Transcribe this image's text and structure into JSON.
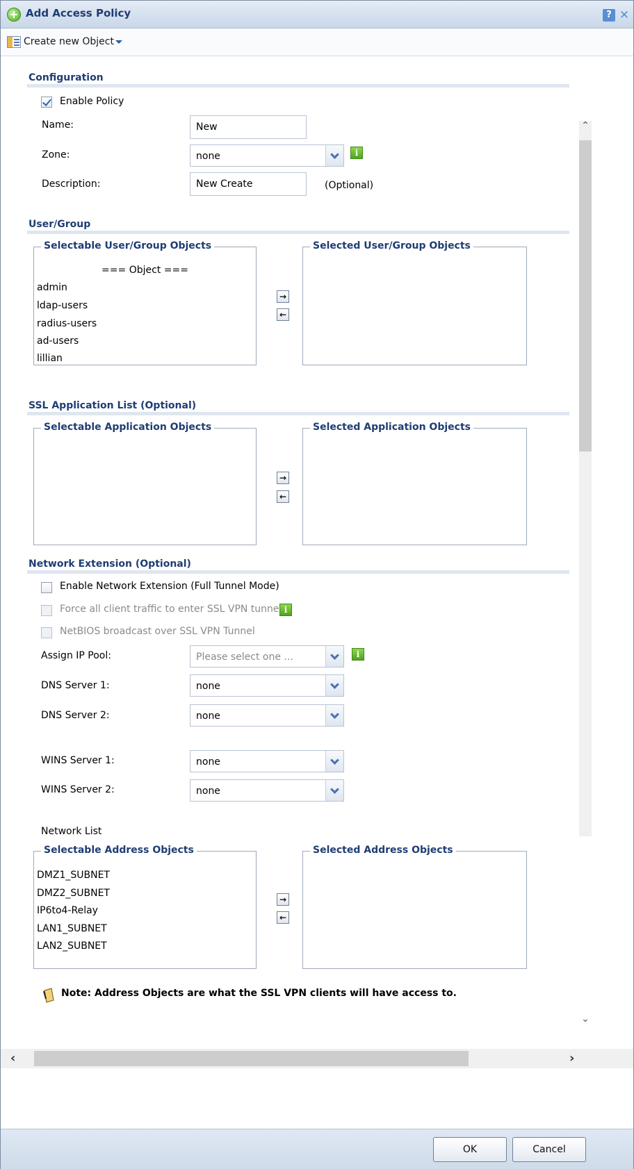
{
  "dialog": {
    "title": "Add Access Policy",
    "help": "?",
    "close": "✕"
  },
  "toolbar": {
    "create_label": "Create new Object"
  },
  "configuration": {
    "heading": "Configuration",
    "enable_policy_label": "Enable Policy",
    "enable_policy_checked": true,
    "name_label": "Name:",
    "name_value": "New",
    "zone_label": "Zone:",
    "zone_value": "none",
    "description_label": "Description:",
    "description_value": "New Create",
    "description_hint": "(Optional)"
  },
  "user_group": {
    "heading": "User/Group",
    "selectable_legend": "Selectable User/Group Objects",
    "selected_legend": "Selected User/Group Objects",
    "list_header": "=== Object ===",
    "items": [
      "admin",
      "ldap-users",
      "radius-users",
      "ad-users",
      "lillian"
    ]
  },
  "ssl_app": {
    "heading": "SSL Application List (Optional)",
    "selectable_legend": "Selectable Application Objects",
    "selected_legend": "Selected Application Objects"
  },
  "network_ext": {
    "heading": "Network Extension (Optional)",
    "enable_label": "Enable Network Extension (Full Tunnel Mode)",
    "force_label": "Force all client traffic to enter SSL VPN tunnel",
    "netbios_label": "NetBIOS broadcast over SSL VPN Tunnel",
    "ip_pool_label": "Assign IP Pool:",
    "ip_pool_value": "Please select one ...",
    "dns1_label": "DNS Server 1:",
    "dns1_value": "none",
    "dns2_label": "DNS Server 2:",
    "dns2_value": "none",
    "wins1_label": "WINS Server 1:",
    "wins1_value": "none",
    "wins2_label": "WINS Server 2:",
    "wins2_value": "none",
    "network_list_label": "Network List",
    "selectable_legend": "Selectable Address Objects",
    "selected_legend": "Selected Address Objects",
    "address_items": [
      "DMZ1_SUBNET",
      "DMZ2_SUBNET",
      "IP6to4-Relay",
      "LAN1_SUBNET",
      "LAN2_SUBNET"
    ],
    "note": "Note: Address Objects are what the SSL VPN clients will have access to."
  },
  "buttons": {
    "move_right": "→",
    "move_left": "←",
    "ok": "OK",
    "cancel": "Cancel"
  },
  "scroll": {
    "up": "⌃",
    "down": "⌄",
    "left": "‹",
    "right": "›"
  }
}
